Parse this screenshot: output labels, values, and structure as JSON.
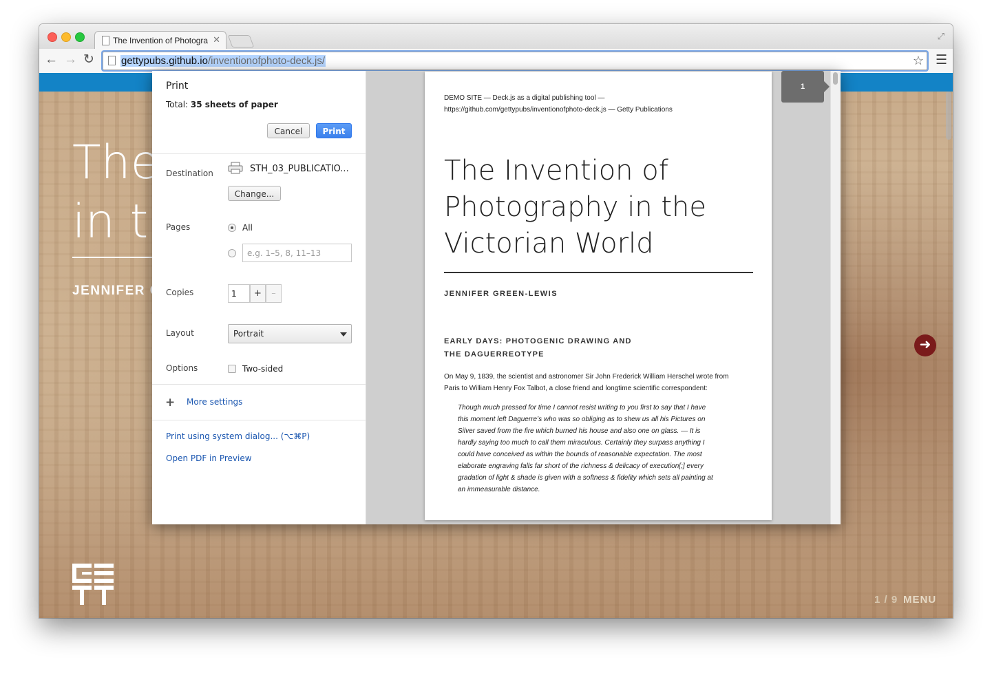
{
  "browser": {
    "tab_title": "The Invention of Photogra",
    "url_host": "gettypubs.github.io",
    "url_path": "/inventionofphoto-deck.js/"
  },
  "page": {
    "hero_title_line1": "The",
    "hero_title_line2": "in th",
    "hero_author": "JENNIFER C",
    "slide_counter": "1 / 9",
    "menu_label": "MENU",
    "accent_color": "#1383c6",
    "arrow_color": "#7a1b1b"
  },
  "print": {
    "heading": "Print",
    "total_label": "Total:",
    "total_value": "35 sheets of paper",
    "cancel_label": "Cancel",
    "print_label": "Print",
    "destination_label": "Destination",
    "destination_value": "STH_03_PUBLICATIO...",
    "change_label": "Change...",
    "pages_label": "Pages",
    "pages_all_label": "All",
    "pages_placeholder": "e.g. 1–5, 8, 11–13",
    "copies_label": "Copies",
    "copies_value": "1",
    "copies_plus": "+",
    "copies_minus": "–",
    "layout_label": "Layout",
    "layout_value": "Portrait",
    "options_label": "Options",
    "two_sided_label": "Two-sided",
    "more_settings_label": "More settings",
    "system_dialog_label": "Print using system dialog... (⌥⌘P)",
    "open_pdf_label": "Open PDF in Preview"
  },
  "preview": {
    "page_number": "1",
    "header_line1": "DEMO SITE — Deck.js as a digital publishing tool —",
    "header_line2": "https://github.com/gettypubs/inventionofphoto-deck.js — Getty Publications",
    "title_line1": "The Invention of",
    "title_line2": "Photography in the",
    "title_line3": "Victorian World",
    "author": "JENNIFER GREEN-LEWIS",
    "section_line1": "EARLY DAYS: PHOTOGENIC DRAWING AND",
    "section_line2": "THE DAGUERREOTYPE",
    "body_line1": "On May 9, 1839, the scientist and astronomer Sir John Frederick William Herschel wrote from",
    "body_line2": "Paris to William Henry Fox Talbot, a close friend and longtime scientific correspondent:",
    "quote_lines": [
      "Though much pressed for time I cannot resist writing to you first to say that I have",
      "this moment left Daguerre’s who was so obliging as to shew us all his Pictures on",
      "Silver saved from the fire which burned his house and also one on glass. — It is",
      "hardly saying too much to call them miraculous. Certainly they surpass anything I",
      "could have conceived as within the bounds of reasonable expectation. The most",
      "elaborate engraving falls far short of the richness & delicacy of execution[;] every",
      "gradation of light & shade is given with a softness & fidelity which sets all painting at",
      "an immeasurable distance."
    ]
  }
}
